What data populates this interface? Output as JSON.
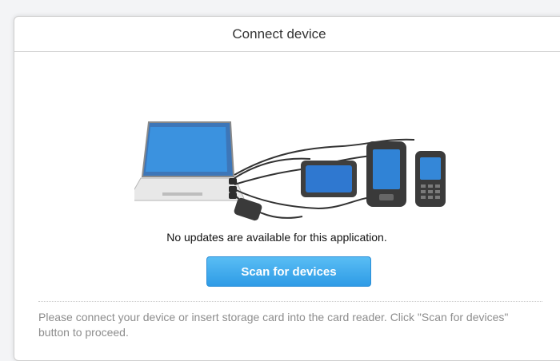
{
  "dialog": {
    "title": "Connect device",
    "status_message": "No updates are available for this application.",
    "scan_button_label": "Scan for devices",
    "hint_text": "Please connect your device or insert storage card into the card reader. Click \"Scan for devices\" button to proceed."
  },
  "illustration": {
    "devices": [
      "laptop-icon",
      "card-reader-icon",
      "tablet-icon",
      "pda-icon",
      "phone-icon"
    ]
  },
  "colors": {
    "accent": "#3aa5ec",
    "hint_text": "#8d8d8d",
    "border": "#cfcfcf"
  }
}
